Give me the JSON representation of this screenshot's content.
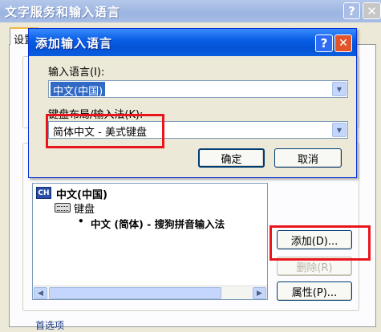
{
  "outer_window": {
    "title": "文字服务和输入语言",
    "help_label": "?",
    "close_label": "✕",
    "tab_label": "设置",
    "group1_fragment_a": "默",
    "group1_fragment_b": "之",
    "group2_fragment_a": "已",
    "group2_fragment_b": "网",
    "installed_services": {
      "badge": "CH",
      "language": "中文(中国)",
      "category": "键盘",
      "bullet": "•",
      "ime": "中文 (简体) - 搜狗拼音输入法"
    },
    "buttons": {
      "add": "添加(D)...",
      "remove": "删除(R)",
      "properties": "属性(P)..."
    },
    "preferences_label": "首选项"
  },
  "dialog": {
    "title": "添加输入语言",
    "help_label": "?",
    "close_label": "✕",
    "input_language_label": "输入语言(I):",
    "input_language_value": "中文(中国)",
    "keyboard_layout_label": "键盘布局/输入法(K):",
    "keyboard_layout_value": "简体中文 - 美式键盘",
    "ok_label": "确定",
    "cancel_label": "取消"
  },
  "icons": {
    "dropdown_arrow": "▼",
    "scroll_left": "◀",
    "scroll_right": "▶"
  },
  "colors": {
    "highlight_red": "#e8151c",
    "selection_blue": "#316ac5",
    "titlebar_blue": "#0553d6"
  }
}
